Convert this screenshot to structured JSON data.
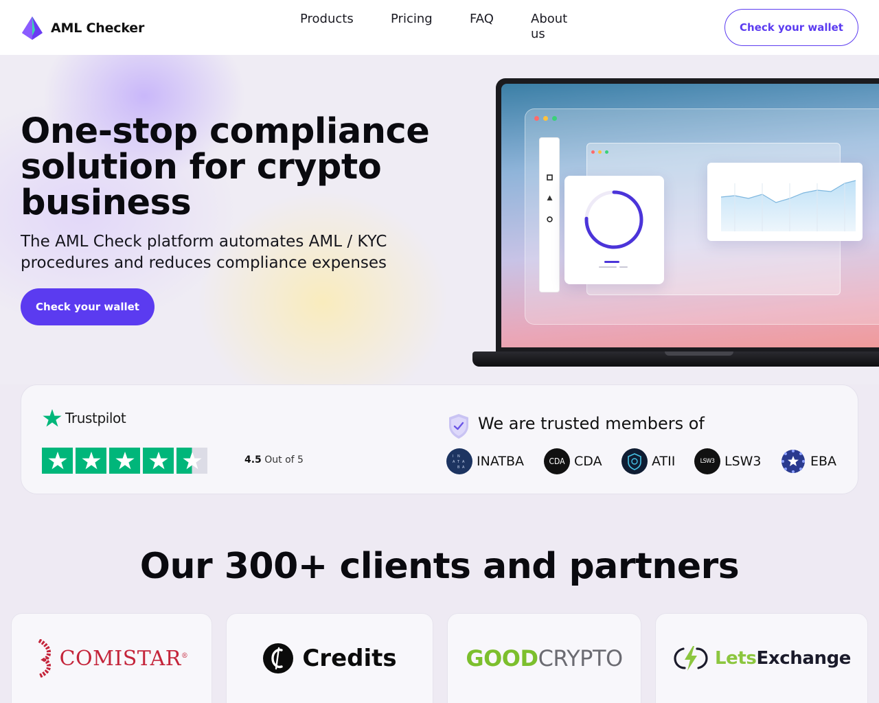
{
  "header": {
    "brand": "AML Checker",
    "nav": [
      {
        "label": "Products"
      },
      {
        "label": "Pricing"
      },
      {
        "label": "FAQ"
      },
      {
        "label": "About us"
      }
    ],
    "cta_label": "Check your wallet"
  },
  "hero": {
    "title": "One-stop compliance solution for crypto business",
    "subtitle": "The AML Check platform automates AML / KYC procedures and reduces compliance expenses",
    "cta_label": "Check your wallet"
  },
  "trust": {
    "trustpilot_name": "Trustpilot",
    "rating_value": "4.5",
    "rating_suffix": "Out of 5",
    "rating": 4.5,
    "trusted_title": "We are trusted members of",
    "members": [
      {
        "name": "INATBA",
        "icon": "inatba-logo"
      },
      {
        "name": "CDA",
        "icon": "cda-logo",
        "mark": "CDA"
      },
      {
        "name": "ATII",
        "icon": "atii-logo"
      },
      {
        "name": "LSW3",
        "icon": "lsw3-logo",
        "mark": "LSW3"
      },
      {
        "name": "EBA",
        "icon": "eba-logo"
      }
    ]
  },
  "clients": {
    "title": "Our 300+ clients and partners",
    "logos": [
      {
        "name": "COMISTAR",
        "mark": "®"
      },
      {
        "name": "Credits"
      },
      {
        "part1": "GOOD",
        "part2": "CRYPTO"
      },
      {
        "part1": "Lets",
        "part2": "Exchange"
      }
    ]
  },
  "colors": {
    "accent": "#5b3bf0",
    "trustpilot_green": "#00b67a",
    "page_bg": "#eeeaf3"
  }
}
